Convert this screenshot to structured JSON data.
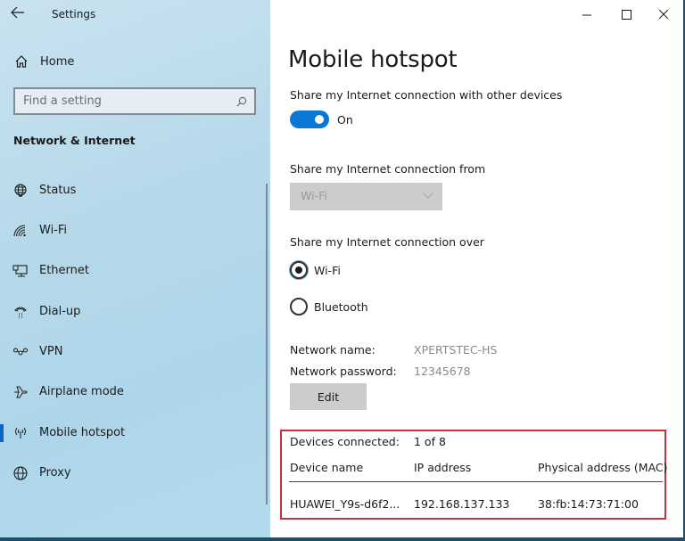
{
  "window": {
    "title": "Settings",
    "caption_buttons": {
      "minimize": "minimize",
      "maximize": "maximize",
      "close": "close"
    }
  },
  "sidebar": {
    "home_label": "Home",
    "search": {
      "placeholder": "Find a setting"
    },
    "section_title": "Network & Internet",
    "items": [
      {
        "label": "Status",
        "icon": "status-globe-icon",
        "selected": false
      },
      {
        "label": "Wi-Fi",
        "icon": "wifi-icon",
        "selected": false
      },
      {
        "label": "Ethernet",
        "icon": "ethernet-icon",
        "selected": false
      },
      {
        "label": "Dial-up",
        "icon": "dialup-icon",
        "selected": false
      },
      {
        "label": "VPN",
        "icon": "vpn-icon",
        "selected": false
      },
      {
        "label": "Airplane mode",
        "icon": "airplane-icon",
        "selected": false
      },
      {
        "label": "Mobile hotspot",
        "icon": "hotspot-icon",
        "selected": true
      },
      {
        "label": "Proxy",
        "icon": "globe-icon",
        "selected": false
      }
    ]
  },
  "main": {
    "page_title": "Mobile hotspot",
    "share_label": "Share my Internet connection with other devices",
    "toggle": {
      "state": "On",
      "on": true
    },
    "share_from_label": "Share my Internet connection from",
    "share_from_value": "Wi-Fi",
    "share_over_label": "Share my Internet connection over",
    "share_over_options": [
      {
        "label": "Wi-Fi",
        "checked": true
      },
      {
        "label": "Bluetooth",
        "checked": false
      }
    ],
    "network_name_label": "Network name:",
    "network_name_value": "XPERTSTEC-HS",
    "network_password_label": "Network password:",
    "network_password_value": "12345678",
    "edit_label": "Edit",
    "devices_connected_label": "Devices connected:",
    "devices_connected_value": "1 of 8",
    "devices_table": {
      "columns": [
        "Device name",
        "IP address",
        "Physical address (MAC)"
      ],
      "rows": [
        [
          "HUAWEI_Y9s-d6f2...",
          "192.168.137.133",
          "38:fb:14:73:71:00"
        ]
      ]
    }
  },
  "colors": {
    "accent": "#0a78d4",
    "highlight_border": "#c8313c",
    "sidebar_bg": "#b6d9ea"
  }
}
